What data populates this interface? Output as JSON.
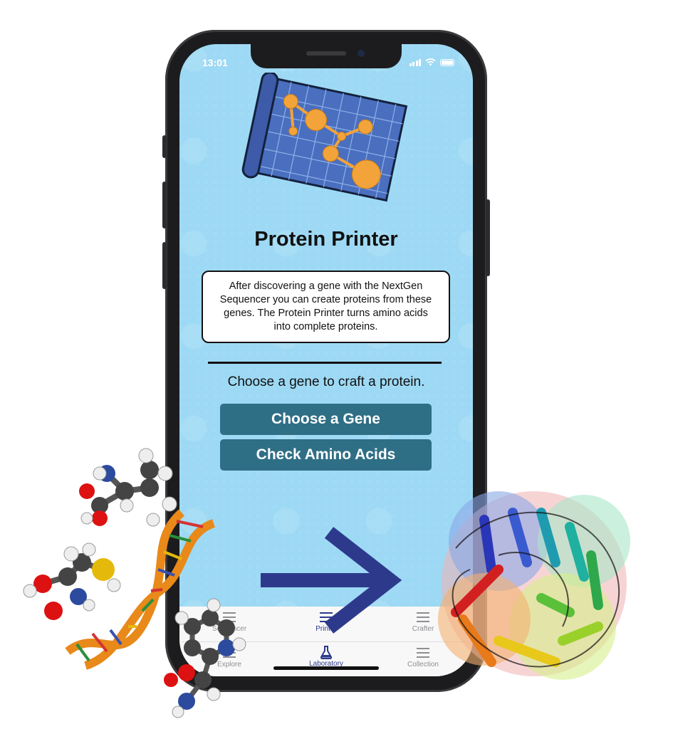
{
  "status_bar": {
    "time": "13:01"
  },
  "screen": {
    "title": "Protein Printer",
    "description": "After discovering a gene with the NextGen Sequencer you can create proteins from these genes. The Protein Printer turns amino acids into complete proteins.",
    "prompt": "Choose a gene to craft a protein.",
    "buttons": {
      "choose_gene": "Choose a Gene",
      "check_amino": "Check Amino Acids"
    }
  },
  "tab_bar": {
    "top_row": [
      {
        "label": "Sequencer",
        "icon": "list-icon",
        "active": false
      },
      {
        "label": "Printer",
        "icon": "list-icon",
        "active": true
      },
      {
        "label": "Crafter",
        "icon": "list-icon",
        "active": false
      }
    ],
    "bottom_row": [
      {
        "label": "Explore",
        "icon": "list-icon",
        "active": false
      },
      {
        "label": "Laboratory",
        "icon": "flask-icon",
        "active": true
      },
      {
        "label": "Collection",
        "icon": "list-icon",
        "active": false
      }
    ]
  },
  "colors": {
    "screen_bg": "#9dd9f4",
    "button": "#2f6f86",
    "active_tab": "#2d3a8c",
    "arrow": "#2d3a8c",
    "blueprint": "#4a6fbf",
    "blueprint_node": "#f2a33a"
  }
}
